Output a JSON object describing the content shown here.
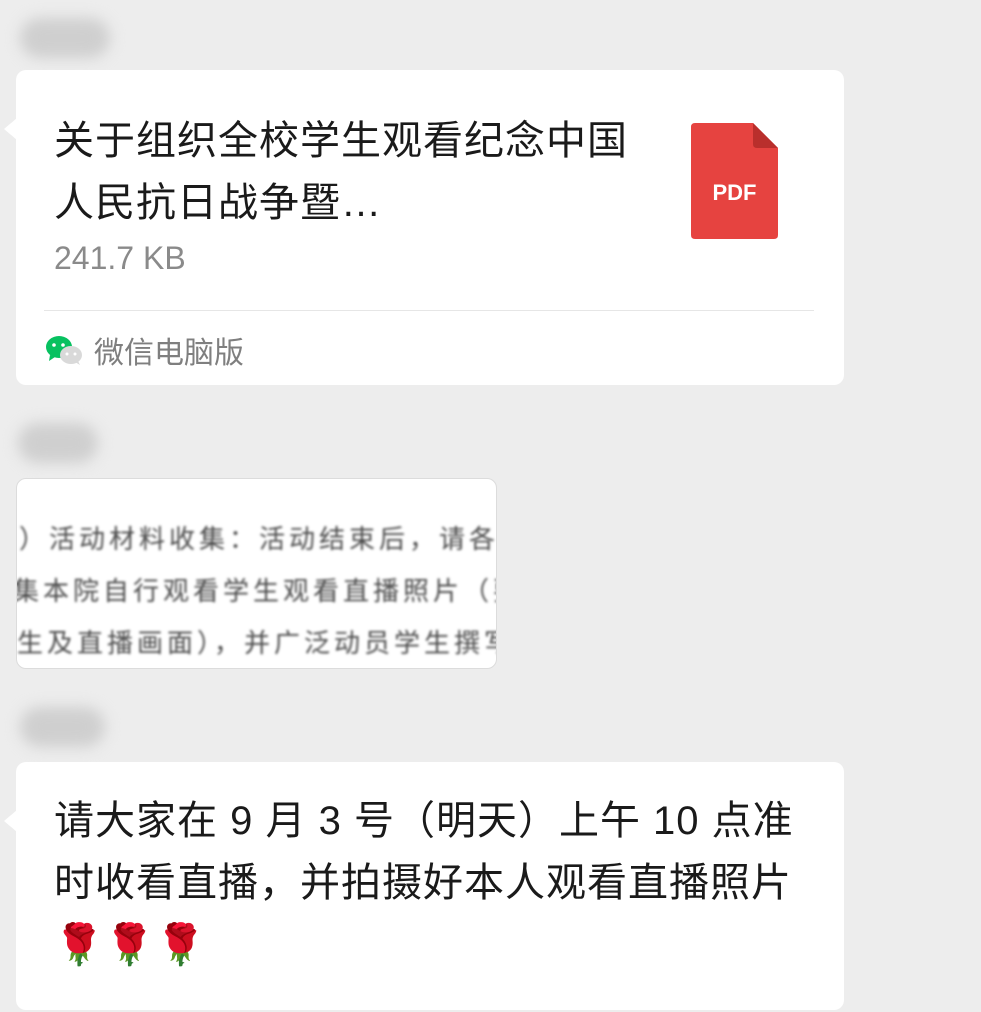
{
  "messages": {
    "file": {
      "title": "关于组织全校学生观看纪念中国人民抗日战争暨…",
      "size": "241.7 KB",
      "file_type": "PDF",
      "source": "微信电脑版",
      "icon": "pdf-file-icon",
      "source_icon": "wechat-icon"
    },
    "image": {
      "lines": [
        "）活动材料收集：活动结束后，请各学院",
        "集本院自行观看学生观看直播照片（要能",
        "生及直播画面），并广泛动员学生撰写心"
      ]
    },
    "text": {
      "content": "请大家在 9 月 3 号（明天）上午 10 点准时收看直播，并拍摄好本人观看直播照片🌹🌹🌹"
    }
  },
  "colors": {
    "background": "#ededed",
    "bubble": "#ffffff",
    "pdf_red": "#e64340",
    "wechat_green": "#07c160"
  }
}
